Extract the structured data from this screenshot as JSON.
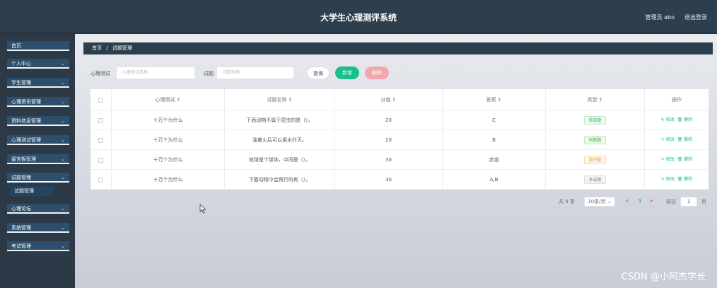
{
  "header": {
    "title": "大学生心理测评系统",
    "user": "管理员 abo",
    "logout": "退出登录"
  },
  "sidebar": {
    "items": [
      {
        "label": "首页",
        "chev": ""
      },
      {
        "label": "个人中心",
        "chev": "⌄"
      },
      {
        "label": "学生管理",
        "chev": "⌄"
      },
      {
        "label": "心理资讯管理",
        "chev": "⌄"
      },
      {
        "label": "资料信息管理",
        "chev": "⌄"
      },
      {
        "label": "心理测试管理",
        "chev": "⌄"
      },
      {
        "label": "留言板管理",
        "chev": "⌄"
      },
      {
        "label": "试题管理",
        "chev": "⌄"
      },
      {
        "label": "试题管理",
        "chev": ""
      },
      {
        "label": "心理论坛",
        "chev": "⌄"
      },
      {
        "label": "系统管理",
        "chev": "⌄"
      },
      {
        "label": "考试管理",
        "chev": "⌄"
      }
    ]
  },
  "breadcrumb": {
    "home": "首页",
    "sep": "/",
    "current": "试题管理"
  },
  "search": {
    "label1": "心理测试",
    "placeholder1": "心理测试名称",
    "label2": "试题",
    "placeholder2": "试题名称",
    "query": "查询",
    "add": "新增",
    "delete": "删除"
  },
  "table": {
    "headers": [
      "",
      "心理测试 ⇕",
      "试题名称 ⇕",
      "分值 ⇕",
      "答案 ⇕",
      "类型 ⇕",
      "操作"
    ],
    "rows": [
      {
        "test": "十万个为什么",
        "name": "下面动物不属于昆虫的是（）。",
        "score": "20",
        "answer": "C",
        "type": "单选题",
        "edit": "修改",
        "del": "删除"
      },
      {
        "test": "十万个为什么",
        "name": "油着火后可以用水扑灭。",
        "score": "20",
        "answer": "B",
        "type": "判断题",
        "edit": "修改",
        "del": "删除"
      },
      {
        "test": "十万个为什么",
        "name": "地球是个球体，中间是（）。",
        "score": "30",
        "answer": "赤道",
        "type": "填空题",
        "edit": "修改",
        "del": "删除"
      },
      {
        "test": "十万个为什么",
        "name": "下面动物中会爬行的有（）。",
        "score": "30",
        "answer": "A,B",
        "type": "多选题",
        "edit": "修改",
        "del": "删除"
      }
    ]
  },
  "pager": {
    "total": "共 4 条",
    "size": "10条/页",
    "prev": "<",
    "page": "1",
    "next": ">",
    "goto": "前往",
    "goto_page": "1",
    "page_unit": "页"
  },
  "watermark": "CSDN @小阿杰学长",
  "colors": {
    "topbar": "#2d3f4d",
    "sidebar_item": "#2d4f6c",
    "add_button": "#1bbf8c",
    "delete_button": "#f4a6ab"
  }
}
